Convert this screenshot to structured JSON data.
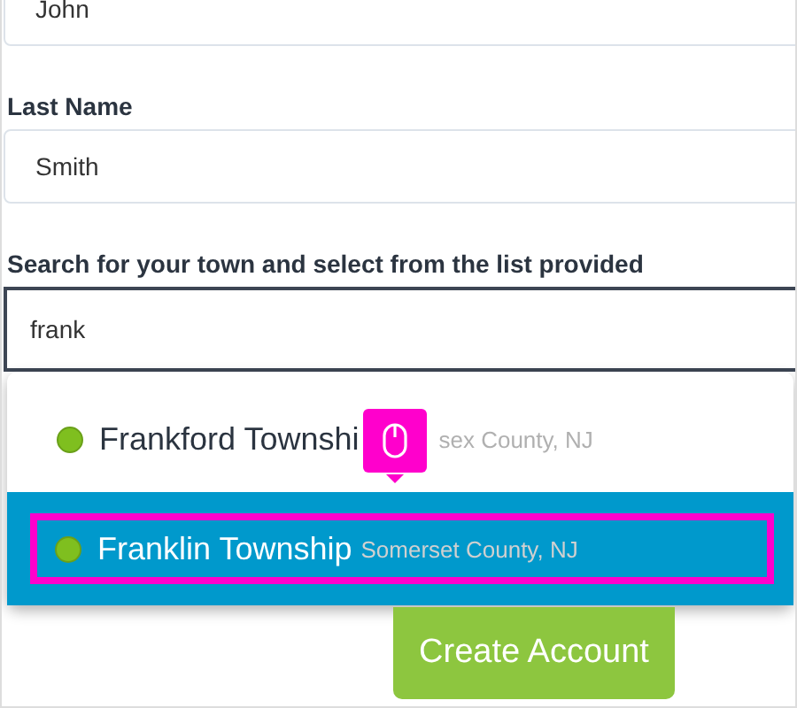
{
  "fields": [
    {
      "value": "John",
      "kind": "text"
    },
    {
      "label": "Last Name",
      "value": "Smith",
      "kind": "text"
    },
    {
      "label": "Search for your town and select from the list provided",
      "value": "frank",
      "kind": "search"
    }
  ],
  "suggestions": [
    {
      "name": "Frankford Townshi",
      "county": "sex County, NJ",
      "selected": false,
      "highlighted": false,
      "covered": true
    },
    {
      "name": "Franklin Township",
      "county": "Somerset County, NJ",
      "selected": true,
      "highlighted": true,
      "covered": false
    }
  ],
  "create_button": "Create Account"
}
